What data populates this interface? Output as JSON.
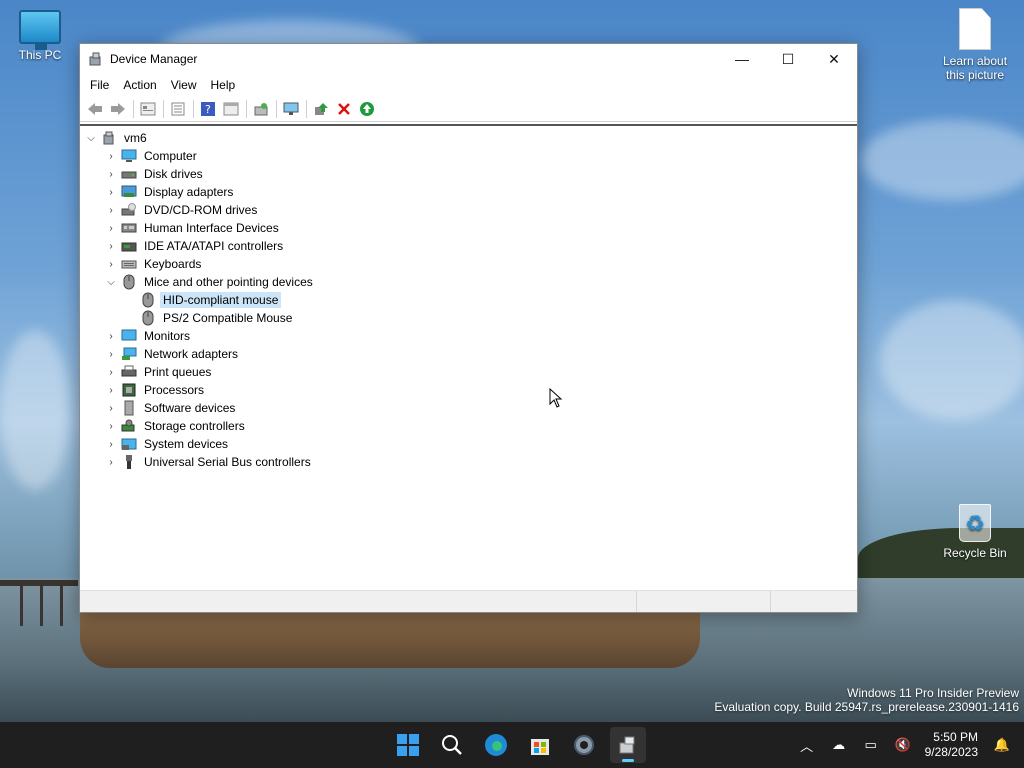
{
  "desktop": {
    "icons": {
      "this_pc": "This PC",
      "learn_picture": "Learn about this picture",
      "recycle_bin": "Recycle Bin"
    },
    "watermark": {
      "line1": "Windows 11 Pro Insider Preview",
      "line2": "Evaluation copy. Build 25947.rs_prerelease.230901-1416"
    }
  },
  "window": {
    "title": "Device Manager",
    "controls": {
      "minimize": "—",
      "maximize": "☐",
      "close": "✕"
    },
    "menu": [
      "File",
      "Action",
      "View",
      "Help"
    ],
    "toolbar": [
      "back-icon",
      "forward-icon",
      "properties-icon",
      "list-icon",
      "help-icon",
      "view-icon",
      "scan-icon",
      "monitor-icon",
      "update-driver-icon",
      "uninstall-icon",
      "enable-icon"
    ],
    "tree": {
      "root": "vm6",
      "categories": [
        {
          "label": "Computer",
          "icon": "computer-icon",
          "expanded": false
        },
        {
          "label": "Disk drives",
          "icon": "disk-icon",
          "expanded": false
        },
        {
          "label": "Display adapters",
          "icon": "display-adapter-icon",
          "expanded": false
        },
        {
          "label": "DVD/CD-ROM drives",
          "icon": "dvd-icon",
          "expanded": false
        },
        {
          "label": "Human Interface Devices",
          "icon": "hid-icon",
          "expanded": false
        },
        {
          "label": "IDE ATA/ATAPI controllers",
          "icon": "ide-icon",
          "expanded": false
        },
        {
          "label": "Keyboards",
          "icon": "keyboard-icon",
          "expanded": false
        },
        {
          "label": "Mice and other pointing devices",
          "icon": "mouse-icon",
          "expanded": true,
          "children": [
            {
              "label": "HID-compliant mouse",
              "selected": true
            },
            {
              "label": "PS/2 Compatible Mouse",
              "selected": false
            }
          ]
        },
        {
          "label": "Monitors",
          "icon": "monitor-icon",
          "expanded": false
        },
        {
          "label": "Network adapters",
          "icon": "network-icon",
          "expanded": false
        },
        {
          "label": "Print queues",
          "icon": "printer-icon",
          "expanded": false
        },
        {
          "label": "Processors",
          "icon": "processor-icon",
          "expanded": false
        },
        {
          "label": "Software devices",
          "icon": "software-icon",
          "expanded": false
        },
        {
          "label": "Storage controllers",
          "icon": "storage-icon",
          "expanded": false
        },
        {
          "label": "System devices",
          "icon": "system-icon",
          "expanded": false
        },
        {
          "label": "Universal Serial Bus controllers",
          "icon": "usb-icon",
          "expanded": false
        }
      ]
    }
  },
  "taskbar": {
    "apps": [
      "start-icon",
      "search-icon",
      "edge-icon",
      "store-icon",
      "settings-icon",
      "device-manager-icon"
    ],
    "clock": {
      "time": "5:50 PM",
      "date": "9/28/2023"
    }
  }
}
